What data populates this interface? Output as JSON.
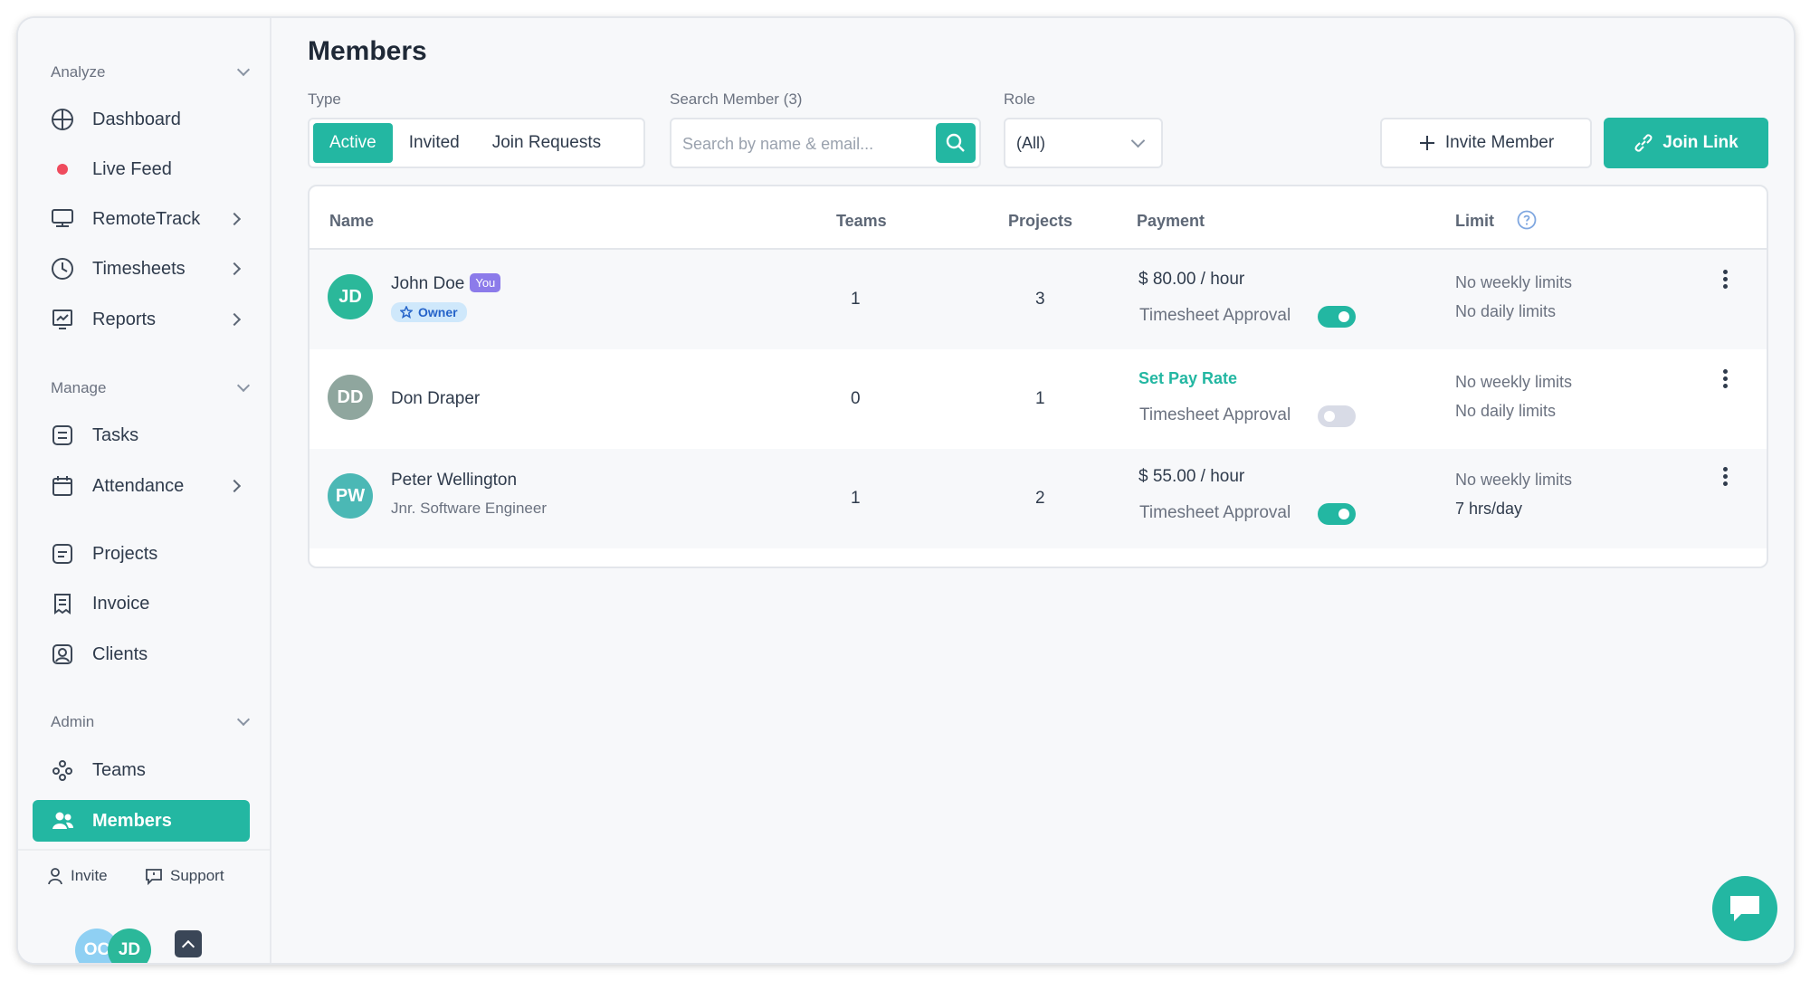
{
  "sidebar": {
    "sections": {
      "analyze": "Analyze",
      "manage": "Manage",
      "admin": "Admin"
    },
    "items": {
      "dashboard": "Dashboard",
      "live_feed": "Live Feed",
      "remotetrack": "RemoteTrack",
      "timesheets": "Timesheets",
      "reports": "Reports",
      "tasks": "Tasks",
      "attendance": "Attendance",
      "projects": "Projects",
      "invoice": "Invoice",
      "clients": "Clients",
      "teams": "Teams",
      "members": "Members"
    },
    "bottom": {
      "invite": "Invite",
      "support": "Support",
      "avatars": [
        "OC",
        "JD"
      ]
    }
  },
  "page": {
    "title": "Members"
  },
  "filters": {
    "type_label": "Type",
    "type_tabs": [
      "Active",
      "Invited",
      "Join Requests"
    ],
    "search_label": "Search Member (3)",
    "search_placeholder": "Search by name & email...",
    "role_label": "Role",
    "role_value": "(All)"
  },
  "actions": {
    "invite_member": "Invite Member",
    "join_link": "Join Link"
  },
  "table": {
    "headers": {
      "name": "Name",
      "teams": "Teams",
      "projects": "Projects",
      "payment": "Payment",
      "limit": "Limit"
    },
    "rows": [
      {
        "initials": "JD",
        "name": "John Doe",
        "you_tag": "You",
        "owner_tag": "Owner",
        "teams": "1",
        "projects": "3",
        "payment": "$ 80.00 / hour",
        "approval_label": "Timesheet Approval",
        "approval_on": true,
        "limit1": "No weekly limits",
        "limit2": "No daily limits",
        "avatar_color": "#2bb89a"
      },
      {
        "initials": "DD",
        "name": "Don Draper",
        "teams": "0",
        "projects": "1",
        "payment": "Set Pay Rate",
        "approval_label": "Timesheet Approval",
        "approval_on": false,
        "limit1": "No weekly limits",
        "limit2": "No daily limits",
        "avatar_color": "#8fa69e"
      },
      {
        "initials": "PW",
        "name": "Peter Wellington",
        "subtitle": "Jnr. Software Engineer",
        "teams": "1",
        "projects": "2",
        "payment": "$ 55.00 / hour",
        "approval_label": "Timesheet Approval",
        "approval_on": true,
        "limit1": "No weekly limits",
        "limit2": "7 hrs/day",
        "avatar_color": "#4bb8b5"
      }
    ]
  },
  "colors": {
    "accent": "#23b7a2",
    "you_tag": "#8c7bea",
    "live_dot": "#ef4b5d"
  }
}
